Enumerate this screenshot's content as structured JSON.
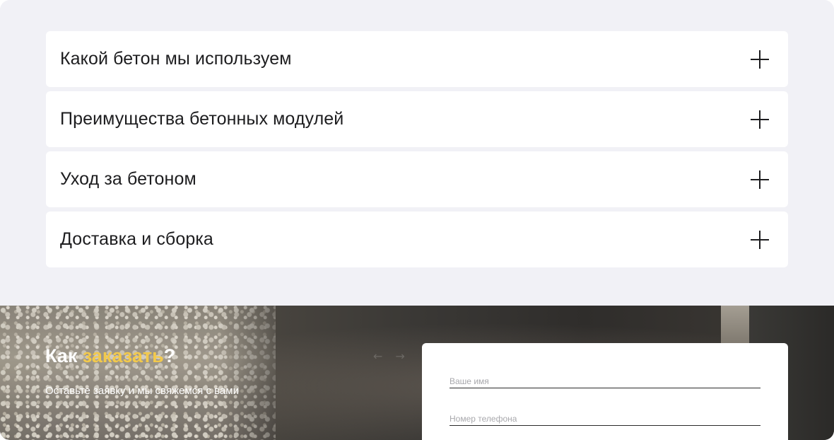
{
  "faq": {
    "items": [
      {
        "title": "Какой бетон мы используем"
      },
      {
        "title": "Преимущества бетонных модулей"
      },
      {
        "title": "Уход за бетоном"
      },
      {
        "title": "Доставка и сборка"
      }
    ]
  },
  "order": {
    "heading_prefix": "Как ",
    "heading_accent": "заказать",
    "heading_suffix": "?",
    "subtitle": "Оставьте заявку и мы свяжемся с вами",
    "accent_color": "#f2c94c",
    "arrow_prev": "←",
    "arrow_next": "→",
    "form": {
      "name_placeholder": "Ваше имя",
      "phone_placeholder": "Номер телефона"
    }
  }
}
